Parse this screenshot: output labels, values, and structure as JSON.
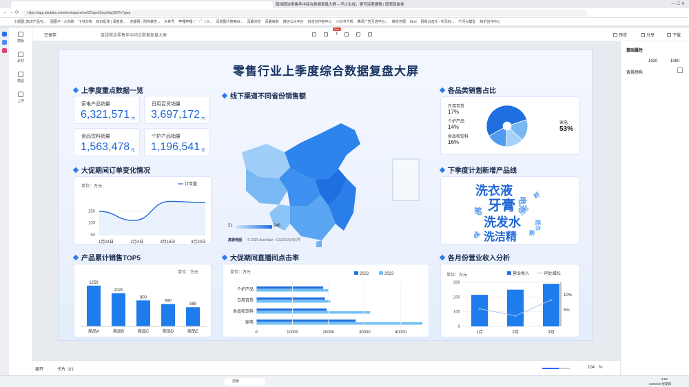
{
  "browser": {
    "window_title": "蓝绿简洁零售年中综合数据复盘大屏 – 不止生成，更可深度编辑 | 图表智能体",
    "url": "https://app.aitubiao.com/workspace/cml37wpvx5yoy6aq3927n7gwq",
    "tab_label": ""
  },
  "bookmarks": [
    "小题图_知识产品与...",
    "图图子 - 大东鹏",
    "飞书文档",
    "知识星球 | 深度连...",
    "花瓣网 - 陪你做生...",
    "头条号",
    "哔哩哔哩 ( ゜- ゜)つ...",
    "百度图片搜索AI...",
    "百趣浏览",
    "百趣商助",
    "微信公众平台",
    "抖音创作者中心",
    "小红书千帆",
    "腾讯广告互选平台...",
    "稿定作图",
    "Kimi",
    "网易云音乐 - 听见好...",
    "千问大模型",
    "知乎创作中心"
  ],
  "app": {
    "back_label": "返回",
    "saved_label": "已保存",
    "doc_title": "蓝绿简洁零售年中综合数据复盘大屏",
    "preview_label": "预览",
    "share_label": "分享",
    "download_label": "下载",
    "new_badge": "New"
  },
  "leftnav": [
    {
      "label": "模板"
    },
    {
      "label": "素材"
    },
    {
      "label": "模型"
    },
    {
      "label": "上传"
    }
  ],
  "rightpanel": {
    "title": "基础属性",
    "w": "1920",
    "h": "1080",
    "bg_label": "背景颜色"
  },
  "bottom": {
    "expand_label": "展开",
    "card_label": "卡片: 1/1",
    "zoom": "104",
    "zoom_unit": "%"
  },
  "taskbar": {
    "search": "搜索",
    "time": "9:52",
    "date": "2026/4/9 星期四"
  },
  "dashboard": {
    "title": "零售行业上季度综合数据复盘大屏",
    "s1_title": "上季度重点数据一览",
    "kpis": [
      {
        "label": "家电产品销量",
        "value": "6,321,571",
        "unit": "元"
      },
      {
        "label": "日用百货销量",
        "value": "3,697,172",
        "unit": "元"
      },
      {
        "label": "食品饮料销量",
        "value": "1,563,478",
        "unit": "元"
      },
      {
        "label": "个护产品销量",
        "value": "1,196,541",
        "unit": "元"
      }
    ],
    "s2_title": "线下渠道不同省份销售额",
    "map": {
      "min": "51",
      "max": "246",
      "credit": "高德地图",
      "copyright": "© 2026 AutoNavi - GS(2019)756号"
    },
    "s3_title": "各品类销售占比",
    "pie_labels": [
      {
        "name": "日用百货",
        "pct": "17%"
      },
      {
        "name": "个护产品",
        "pct": "14%"
      },
      {
        "name": "食品和饮料",
        "pct": "16%"
      },
      {
        "name": "家电",
        "pct": "53%"
      }
    ],
    "s4_title": "大促期间订单变化情况",
    "s5_title": "下季度计划新增产品线",
    "wordcloud": [
      "洗衣液",
      "牙膏",
      "洗发水",
      "洗洁精",
      "电池",
      "笔",
      "红包",
      "纸巾",
      "袜",
      "杯",
      "刷"
    ],
    "s6_title": "产品累计销售TOP5",
    "s7_title": "大促期间直播间点击率",
    "s8_title": "各月份营业收入分析",
    "unit_label": "单位：万元"
  },
  "chart_data": [
    {
      "type": "line",
      "title": "大促期间订单变化情况",
      "legend": [
        "订单量"
      ],
      "x": [
        "1月24日",
        "2月4日",
        "3月16日",
        "3月20日"
      ],
      "series": [
        {
          "name": "订单量",
          "values": [
            148,
            110,
            190,
            185
          ]
        }
      ],
      "yticks": [
        50,
        100,
        150
      ],
      "ylabel": "单位：万元"
    },
    {
      "type": "bar",
      "title": "产品累计销售TOP5",
      "categories": [
        "商品A",
        "商品B",
        "商品C",
        "商品D",
        "商品E"
      ],
      "values": [
        1256,
        1020,
        800,
        690,
        589
      ],
      "ylabel": "单位：万元"
    },
    {
      "type": "bar",
      "orientation": "horizontal",
      "title": "大促期间直播间点击率",
      "categories": [
        "个护产品",
        "日用百货",
        "食品和饮料",
        "家电"
      ],
      "series": [
        {
          "name": "2022",
          "values": [
            18500,
            19000,
            19500,
            27500
          ]
        },
        {
          "name": "2023",
          "values": [
            20000,
            20500,
            31500,
            46000
          ]
        }
      ],
      "xticks": [
        0,
        10000,
        20000,
        30000,
        40000
      ],
      "ylabel": "单位：万元"
    },
    {
      "type": "bar",
      "title": "各月份营业收入分析",
      "categories": [
        "1月",
        "2月",
        "3月"
      ],
      "series": [
        {
          "name": "营业收入",
          "values": [
            215,
            250,
            290
          ]
        },
        {
          "name": "同比增长",
          "values": [
            5.0,
            3.0,
            7.5
          ]
        }
      ],
      "yticks": [
        0,
        100,
        200,
        300
      ],
      "y2ticks": [
        "5%",
        "10%"
      ],
      "ylabel": "单位：万元"
    },
    {
      "type": "pie",
      "title": "各品类销售占比",
      "categories": [
        "日用百货",
        "个护产品",
        "食品和饮料",
        "家电"
      ],
      "values": [
        17,
        14,
        16,
        53
      ]
    }
  ]
}
